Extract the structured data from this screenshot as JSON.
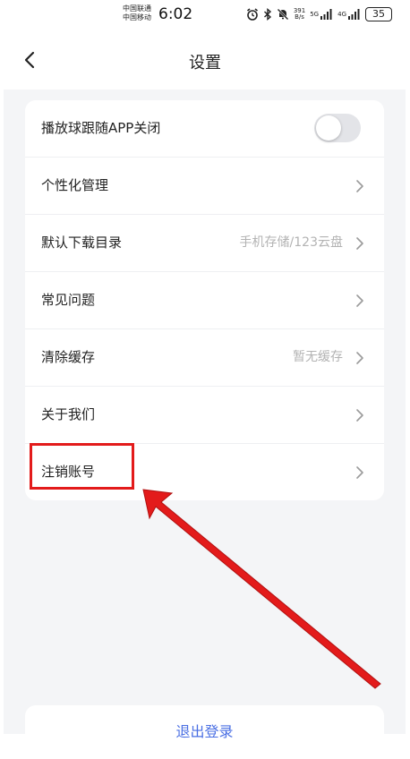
{
  "status_bar": {
    "carrier_1": "中国联通",
    "carrier_2": "中国移动",
    "time": "6:02",
    "net_speed_value": "391",
    "net_speed_unit": "B/s",
    "net_tag_1": "5G",
    "net_tag_2": "4G",
    "battery": "35"
  },
  "header": {
    "title": "设置",
    "back_icon": "chevron-left-icon"
  },
  "settings": {
    "items": [
      {
        "label": "播放球跟随APP关闭",
        "control": "toggle",
        "toggle_on": false
      },
      {
        "label": "个性化管理",
        "value": ""
      },
      {
        "label": "默认下载目录",
        "value": "手机存储/123云盘"
      },
      {
        "label": "常见问题",
        "value": ""
      },
      {
        "label": "清除缓存",
        "value": "暂无缓存"
      },
      {
        "label": "关于我们",
        "value": ""
      },
      {
        "label": "注销账号",
        "value": ""
      }
    ]
  },
  "logout": {
    "label": "退出登录"
  },
  "annotation": {
    "color": "#e31b1b",
    "target": "注销账号"
  },
  "colors": {
    "accent": "#4a6fe3",
    "background": "#f4f5f7",
    "annotation": "#e31b1b"
  }
}
